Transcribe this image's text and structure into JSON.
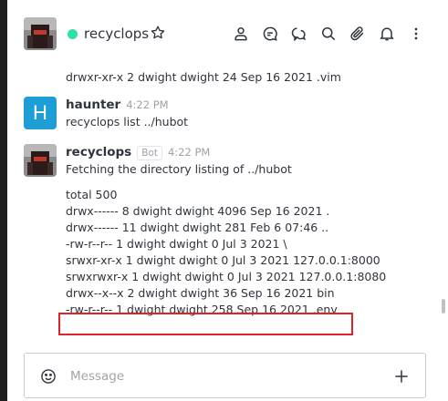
{
  "header": {
    "room_name": "recyclops",
    "status_color": "#2de0a5",
    "icons": [
      "user-info-icon",
      "discussion-icon",
      "threads-icon",
      "search-icon",
      "attachment-icon",
      "notification-bell-icon",
      "kebab-menu-icon"
    ]
  },
  "messages": {
    "top_fragment": "drwxr-xr-x 2 dwight dwight 24 Sep 16 2021 .vim",
    "haunter": {
      "avatar_letter": "H",
      "author": "haunter",
      "time": "4:22 PM",
      "text": "recyclops list ../hubot"
    },
    "recyclops": {
      "author": "recyclops",
      "badge": "Bot",
      "time": "4:22 PM",
      "text": "Fetching the directory listing of ../hubot",
      "listing": [
        "total 500",
        "drwx------ 8 dwight dwight 4096 Sep 16 2021 .",
        "drwx------ 11 dwight dwight 281 Feb 6 07:46 ..",
        "-rw-r--r-- 1 dwight dwight 0 Jul 3 2021 \\",
        "srwxr-xr-x 1 dwight dwight 0 Jul 3 2021 127.0.0.1:8000",
        "srwxrwxr-x 1 dwight dwight 0 Jul 3 2021 127.0.0.1:8080",
        "drwx--x--x 2 dwight dwight 36 Sep 16 2021 bin",
        "-rw-r--r-- 1 dwight dwight 258 Sep 16 2021 .env"
      ]
    }
  },
  "composer": {
    "placeholder": "Message"
  },
  "colors": {
    "highlight_border": "#e22227",
    "bot_avatar_bg": "#1d9fd6"
  }
}
